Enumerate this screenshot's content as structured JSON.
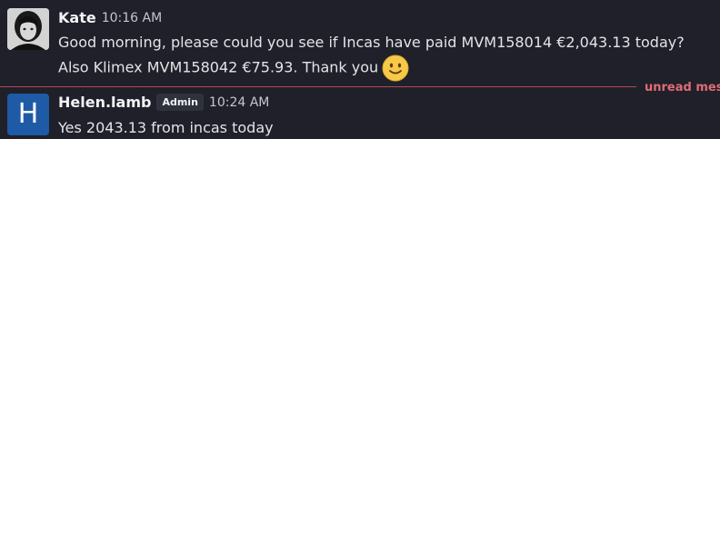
{
  "messages": [
    {
      "author": "Kate",
      "time": "10:16 AM",
      "text": "Good morning, please could you see if Incas have paid MVM158014 €2,043.13 today? Also Klimex MVM158042 €75.93. Thank you",
      "emoji": "slightly-smiling-face-icon",
      "avatar": "photo"
    },
    {
      "author": "Helen.lamb",
      "badge": "Admin",
      "time": "10:24 AM",
      "text": "Yes 2043.13 from incas today",
      "avatar_letter": "H",
      "avatar_color": "#1e5aa6"
    }
  ],
  "divider": {
    "label": "unread mes",
    "color": "#e06c75"
  },
  "colors": {
    "background": "#1f2029",
    "text": "#e3e4e8",
    "author": "#f2f3f5",
    "timestamp": "#c4c7ce"
  }
}
